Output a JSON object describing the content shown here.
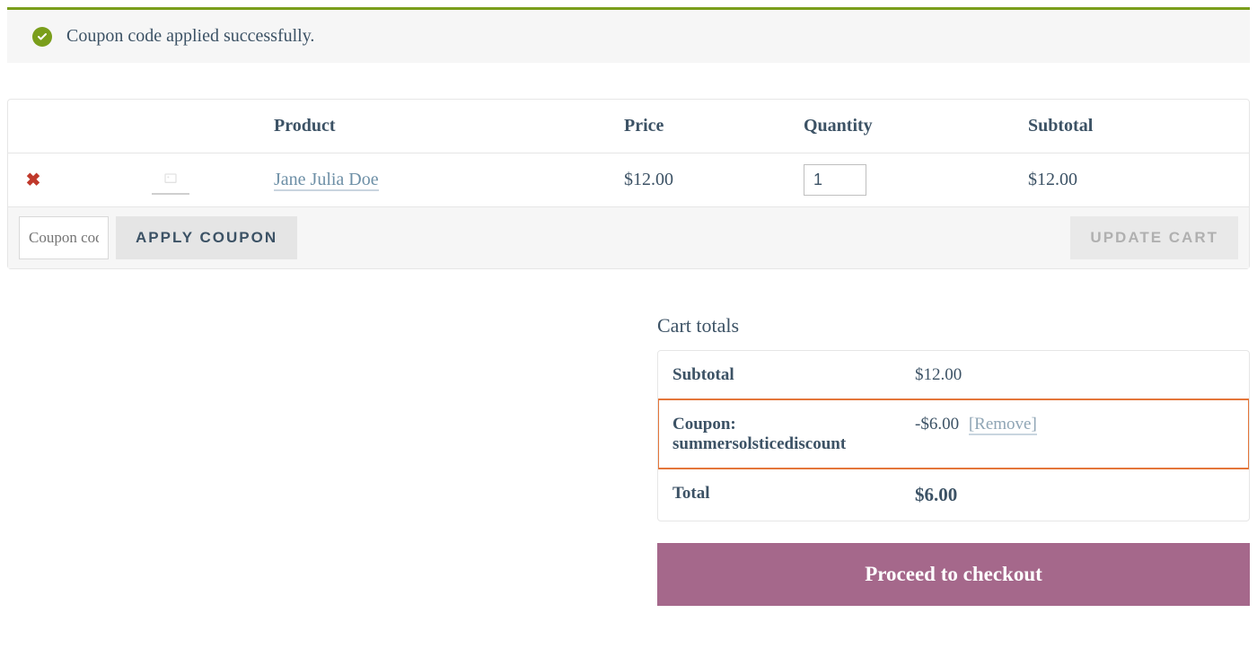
{
  "notice": {
    "text": "Coupon code applied successfully."
  },
  "cart": {
    "headers": {
      "product": "Product",
      "price": "Price",
      "quantity": "Quantity",
      "subtotal": "Subtotal"
    },
    "item": {
      "name": "Jane Julia Doe",
      "price": "$12.00",
      "qty": "1",
      "subtotal": "$12.00"
    },
    "coupon_placeholder": "Coupon code",
    "apply_label": "Apply coupon",
    "update_label": "Update cart"
  },
  "totals": {
    "title": "Cart totals",
    "subtotal_label": "Subtotal",
    "subtotal_value": "$12.00",
    "coupon_label_prefix": "Coupon:",
    "coupon_code": "summersolsticediscount",
    "coupon_value": "-$6.00",
    "remove_label": "[Remove]",
    "total_label": "Total",
    "total_value": "$6.00",
    "checkout_label": "Proceed to checkout"
  }
}
